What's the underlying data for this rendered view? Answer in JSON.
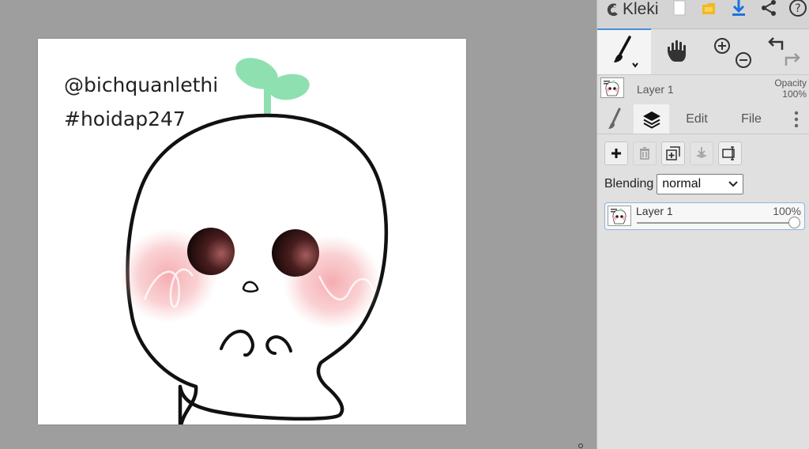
{
  "app": {
    "name": "Kleki"
  },
  "canvas": {
    "text_lines": [
      "@bichquanlethi",
      "#hoidap247"
    ]
  },
  "topbar": {
    "icons": [
      "kleki-logo-icon",
      "new-image-icon",
      "save-icon",
      "download-icon",
      "share-icon",
      "help-icon"
    ],
    "help_glyph": "?"
  },
  "tools": {
    "active": "brush",
    "items": [
      "brush-tool-icon",
      "hand-tool-icon",
      "zoom-in-icon",
      "zoom-out-icon",
      "undo-icon",
      "redo-icon"
    ]
  },
  "layer_preview": {
    "name": "Layer 1",
    "opacity_label": "Opacity",
    "opacity_value": "100%"
  },
  "tabs": [
    {
      "label": "",
      "icon": "brush-tab-icon"
    },
    {
      "label": "",
      "icon": "layers-tab-icon",
      "active": true
    },
    {
      "label": "Edit"
    },
    {
      "label": "File"
    },
    {
      "label": "",
      "icon": "more-options-icon"
    }
  ],
  "layers": {
    "actions": [
      {
        "icon": "add-layer-icon",
        "enabled": true
      },
      {
        "icon": "delete-layer-icon",
        "enabled": false
      },
      {
        "icon": "duplicate-layer-icon",
        "enabled": true
      },
      {
        "icon": "merge-down-icon",
        "enabled": false
      },
      {
        "icon": "rename-layer-icon",
        "enabled": true
      }
    ],
    "blending_label": "Blending",
    "blending_value": "normal",
    "items": [
      {
        "name": "Layer 1",
        "opacity": "100%",
        "opacity_fraction": 1.0
      }
    ]
  },
  "colors": {
    "sprout": "#8fe0b0",
    "blush": "#f4a3a8",
    "eye_dark": "#1a0c0c",
    "accent": "#4a90d9",
    "download": "#1e73d9",
    "save": "#f2b81d"
  }
}
